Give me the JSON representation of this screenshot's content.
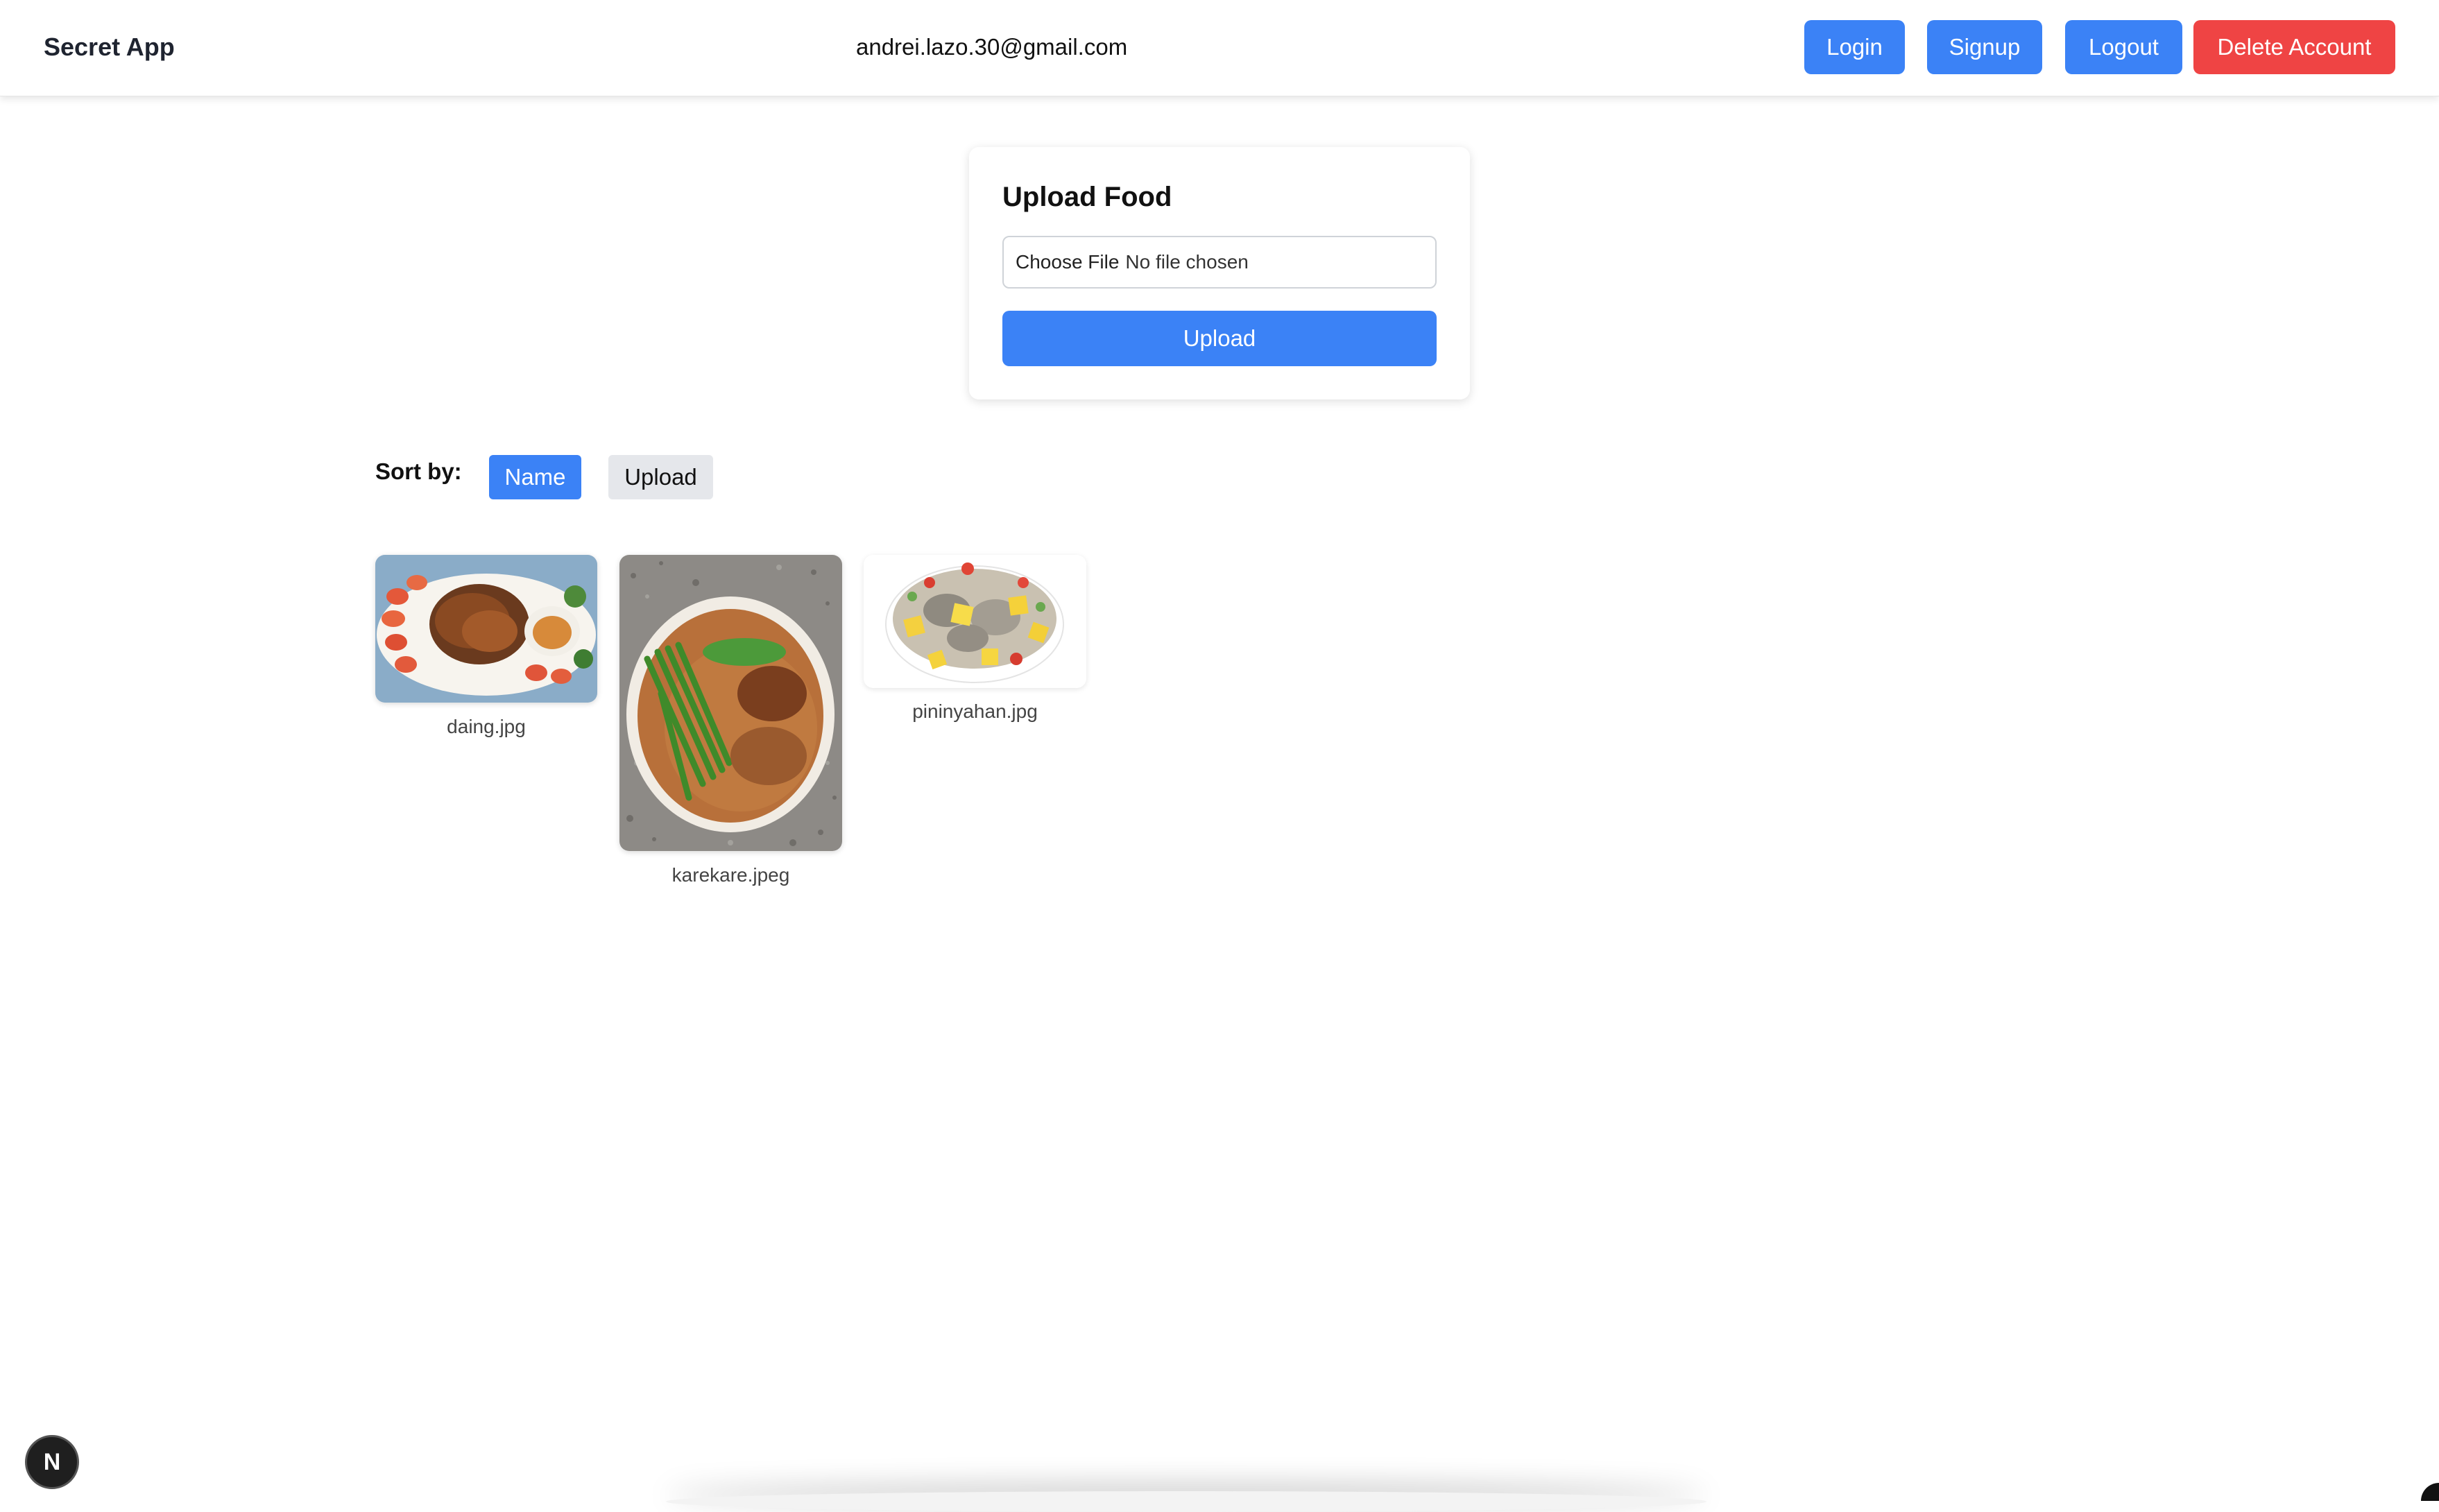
{
  "navbar": {
    "brand": "Secret App",
    "user_email": "andrei.lazo.30@gmail.com",
    "buttons": {
      "login": "Login",
      "signup": "Signup",
      "logout": "Logout",
      "delete_account": "Delete Account"
    }
  },
  "upload_card": {
    "title": "Upload Food",
    "file_input": {
      "button_label": "Choose File",
      "status": "No file chosen"
    },
    "upload_button": "Upload"
  },
  "sort": {
    "label": "Sort by:",
    "options": [
      "Name",
      "Upload"
    ],
    "active": "Name"
  },
  "gallery": {
    "items": [
      {
        "filename": "daing.jpg"
      },
      {
        "filename": "karekare.jpeg"
      },
      {
        "filename": "pininyahan.jpg"
      }
    ]
  },
  "dev_badge": {
    "label": "N",
    "icon": "nextjs-icon"
  },
  "colors": {
    "primary": "#3b82f6",
    "danger": "#ef4444",
    "secondary": "#e5e7eb"
  }
}
